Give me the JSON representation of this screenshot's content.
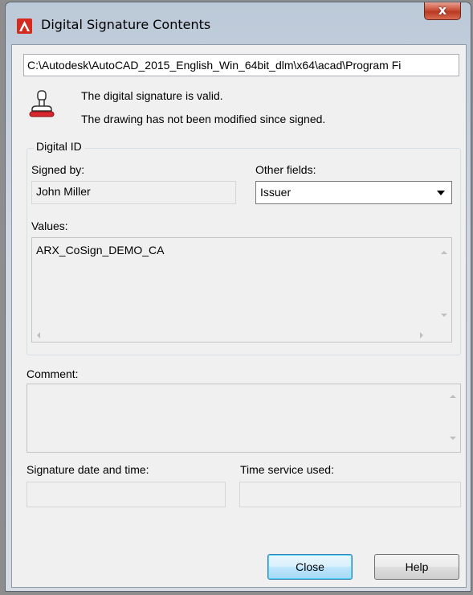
{
  "window": {
    "title": "Digital Signature Contents",
    "close_glyph": "x",
    "accent_color": "#c8513a"
  },
  "file_path": "C:\\Autodesk\\AutoCAD_2015_English_Win_64bit_dlm\\x64\\acad\\Program Fi",
  "status": {
    "icon": "stamp-icon",
    "valid_message": "The digital signature is valid.",
    "modified_message": "The drawing has not been modified since signed."
  },
  "digital_id": {
    "group_label": "Digital ID",
    "signed_by_label": "Signed by:",
    "signed_by_value": "John Miller",
    "other_fields_label": "Other fields:",
    "other_fields_selected": "Issuer",
    "values_label": "Values:",
    "values_text": "ARX_CoSign_DEMO_CA"
  },
  "comment": {
    "label": "Comment:",
    "value": ""
  },
  "signature_date": {
    "label": "Signature date and time:",
    "value": ""
  },
  "time_service": {
    "label": "Time service used:",
    "value": ""
  },
  "buttons": {
    "close_label": "Close",
    "help_label": "Help"
  }
}
